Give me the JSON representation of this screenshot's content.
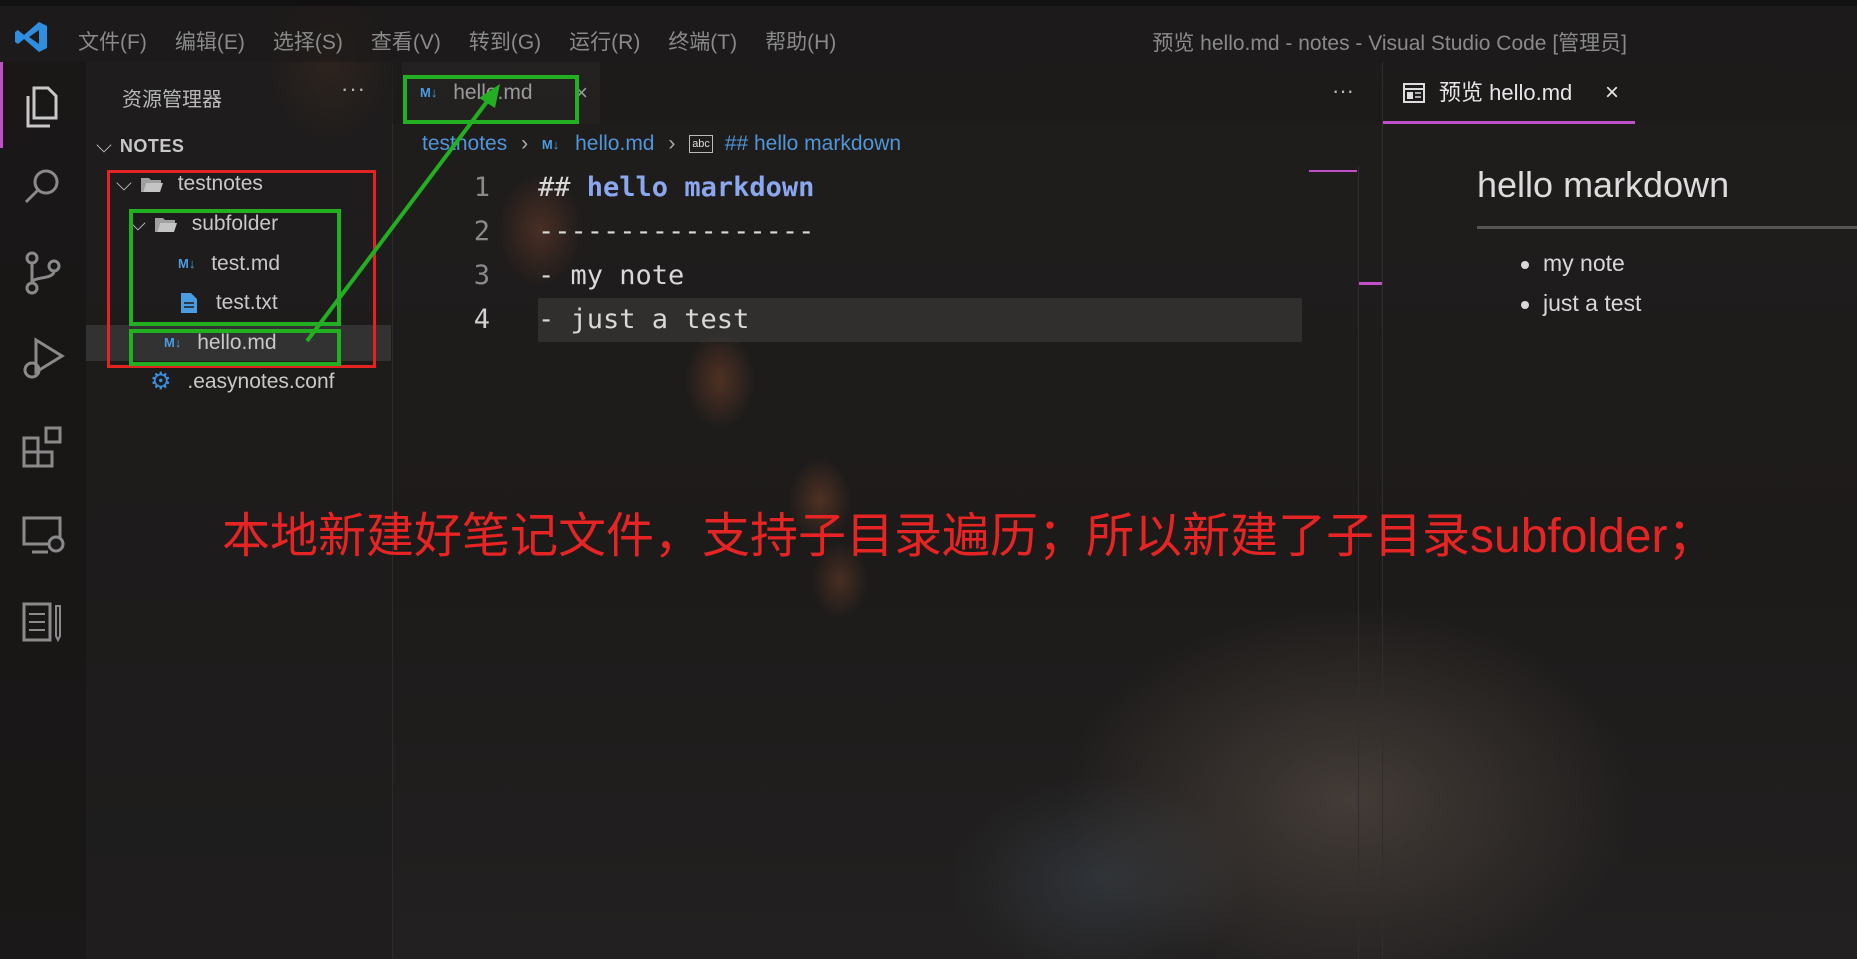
{
  "titlebar": {
    "menu": [
      "文件(F)",
      "编辑(E)",
      "选择(S)",
      "查看(V)",
      "转到(G)",
      "运行(R)",
      "终端(T)",
      "帮助(H)"
    ],
    "window_title": "预览 hello.md - notes - Visual Studio Code [管理员]"
  },
  "activity_bar": {
    "items": [
      "files-icon",
      "search-icon",
      "source-control-icon",
      "run-debug-icon",
      "extensions-icon",
      "remote-explorer-icon",
      "notes-icon"
    ]
  },
  "sidebar": {
    "title": "资源管理器",
    "more": "···",
    "section": "NOTES",
    "tree": {
      "root_folder": "testnotes",
      "subfolder": "subfolder",
      "sub_file_md": "test.md",
      "sub_file_txt": "test.txt",
      "file_md": "hello.md",
      "config_file": ".easynotes.conf"
    }
  },
  "editor": {
    "tab_label": "hello.md",
    "tab_close": "×",
    "more": "···",
    "md_badge": "M↓",
    "breadcrumb": {
      "folder": "testnotes",
      "file": "hello.md",
      "symbol_badge": "abc",
      "symbol": "## hello markdown"
    },
    "lines": [
      {
        "num": "1",
        "prefix": "## ",
        "heading": "hello markdown",
        "text": ""
      },
      {
        "num": "2",
        "prefix": "",
        "heading": "",
        "text": "-----------------"
      },
      {
        "num": "3",
        "prefix": "",
        "heading": "",
        "text": "- my note"
      },
      {
        "num": "4",
        "prefix": "",
        "heading": "",
        "text": "- just a test"
      }
    ]
  },
  "preview": {
    "tab_label": "预览 hello.md",
    "tab_close": "×",
    "heading": "hello markdown",
    "items": [
      "my note",
      "just a test"
    ]
  },
  "annotation": {
    "note": "本地新建好笔记文件，支持子目录遍历；所以新建了子目录subfolder；",
    "colors": {
      "red": "#e32222",
      "green": "#22b022"
    }
  }
}
